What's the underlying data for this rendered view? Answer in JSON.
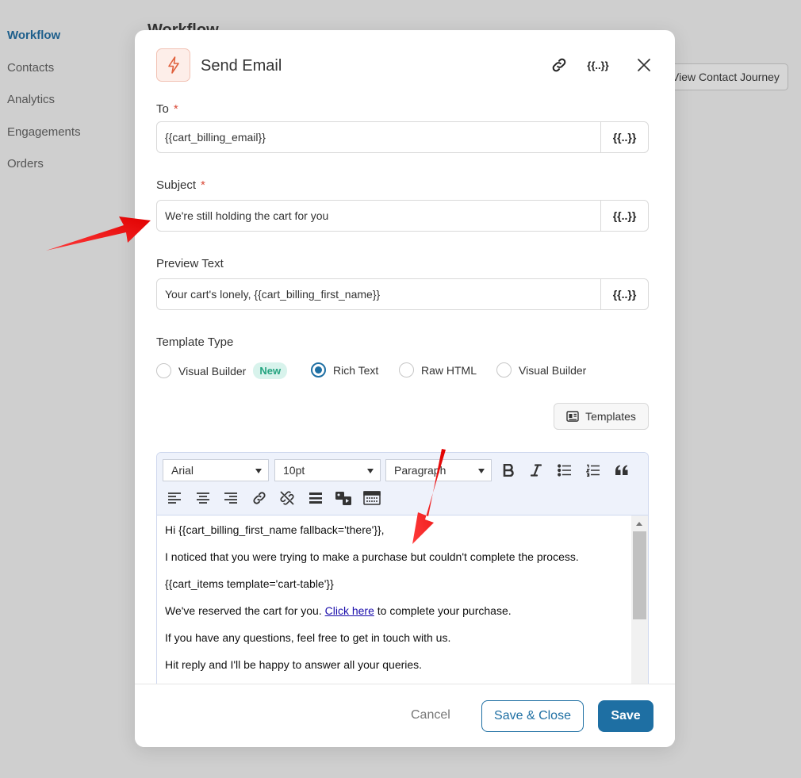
{
  "sidebar": {
    "items": [
      {
        "label": "Workflow",
        "active": true
      },
      {
        "label": "Contacts"
      },
      {
        "label": "Analytics"
      },
      {
        "label": "Engagements"
      },
      {
        "label": "Orders"
      }
    ]
  },
  "background": {
    "page_title": "Workflow",
    "journey_button": "View Contact Journey"
  },
  "modal": {
    "title": "Send Email",
    "header_icon": "lightning-bolt-icon",
    "to": {
      "label": "To",
      "value": "{{cart_billing_email}}"
    },
    "subject": {
      "label": "Subject",
      "value": "We're still holding the cart for you"
    },
    "preview": {
      "label": "Preview Text",
      "value": "Your cart's lonely, {{cart_billing_first_name}}"
    },
    "merge_tag_label": "{{..}}",
    "required_mark": "*",
    "template_type": {
      "label": "Template Type",
      "options": [
        {
          "label": "Visual Builder",
          "badge": "New"
        },
        {
          "label": "Rich Text",
          "selected": true
        },
        {
          "label": "Raw HTML"
        },
        {
          "label": "Visual Builder"
        }
      ]
    },
    "templates_button": "Templates",
    "editor": {
      "font": "Arial",
      "size": "10pt",
      "block": "Paragraph",
      "content": {
        "line1": "Hi {{cart_billing_first_name fallback='there'}},",
        "line2": "I noticed that you were trying to make a purchase but couldn't complete the process.",
        "line3": "{{cart_items template='cart-table'}}",
        "line4_before": "We've reserved the cart for you. ",
        "line4_link": "Click here",
        "line4_after": " to complete your purchase.",
        "line5": "If you have any questions, feel free to get in touch with us.",
        "line6": "Hit reply and I'll be happy to answer all your queries."
      }
    },
    "footer": {
      "cancel": "Cancel",
      "save_close": "Save & Close",
      "save": "Save"
    }
  },
  "colors": {
    "primary": "#1e6fa3",
    "required": "#d94a38",
    "badge_bg": "#d8f3ec",
    "badge_text": "#23a37f",
    "annotation_arrow": "#ff0000"
  }
}
